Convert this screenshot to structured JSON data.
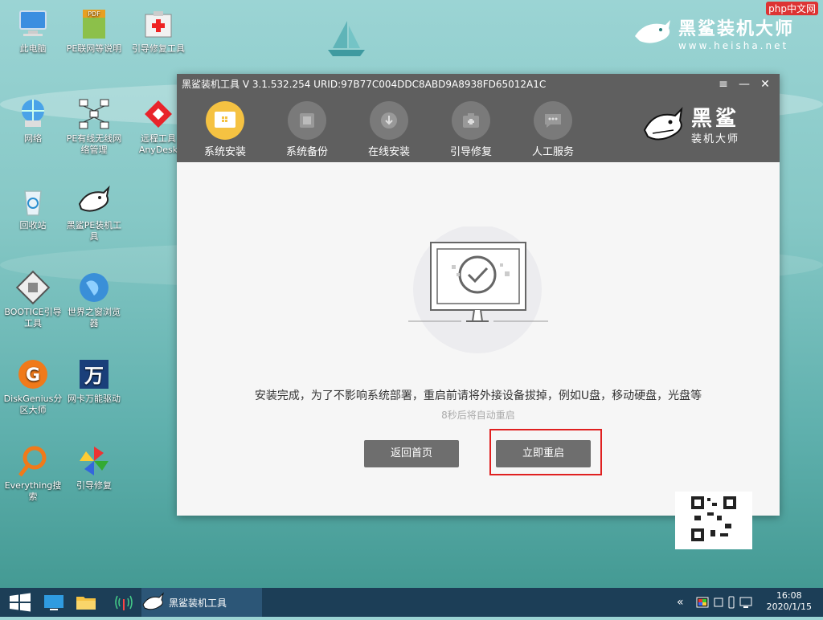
{
  "desktop": {
    "icons": [
      {
        "label": "此电脑",
        "icon": "computer-icon"
      },
      {
        "label": "PE联网等说明",
        "icon": "pdf-icon"
      },
      {
        "label": "引导修复工具",
        "icon": "first-aid-icon"
      },
      {
        "label": "网络",
        "icon": "network-globe-icon"
      },
      {
        "label": "PE有线无线网络管理",
        "icon": "network-topology-icon"
      },
      {
        "label": "远程工具AnyDesk",
        "icon": "anydesk-icon"
      },
      {
        "label": "回收站",
        "icon": "recycle-bin-icon"
      },
      {
        "label": "黑鲨PE装机工具",
        "icon": "shark-icon"
      },
      {
        "label": "BOOTICE引导工具",
        "icon": "disk-tool-icon"
      },
      {
        "label": "世界之窗浏览器",
        "icon": "browser-globe-icon"
      },
      {
        "label": "DiskGenius分区大师",
        "icon": "diskgenius-icon"
      },
      {
        "label": "网卡万能驱动",
        "icon": "wan-driver-icon"
      },
      {
        "label": "Everything搜索",
        "icon": "everything-search-icon"
      },
      {
        "label": "引导修复",
        "icon": "pinwheel-icon"
      }
    ]
  },
  "watermark": {
    "brand": "黑鲨装机大师",
    "url": "www.heisha.net",
    "php": "php中文网"
  },
  "window": {
    "title": "黑鲨装机工具 V 3.1.532.254 URID:97B77C004DDC8ABD9A8938FD65012A1C",
    "tabs": [
      {
        "label": "系统安装",
        "active": true
      },
      {
        "label": "系统备份",
        "active": false
      },
      {
        "label": "在线安装",
        "active": false
      },
      {
        "label": "引导修复",
        "active": false
      },
      {
        "label": "人工服务",
        "active": false
      }
    ],
    "logo_line1": "黑鲨",
    "logo_line2": "装机大师",
    "message": "安装完成，为了不影响系统部署，重启前请将外接设备拔掉，例如U盘，移动硬盘，光盘等",
    "countdown": "8秒后将自动重启",
    "back_button": "返回首页",
    "restart_button": "立即重启"
  },
  "taskbar": {
    "app_label": "黑鲨装机工具",
    "time": "16:08",
    "date": "2020/1/15"
  },
  "colors": {
    "accent": "#f5c242",
    "window_chrome": "#5f5f5f",
    "highlight": "#e02020",
    "taskbar": "#1c3e57"
  }
}
